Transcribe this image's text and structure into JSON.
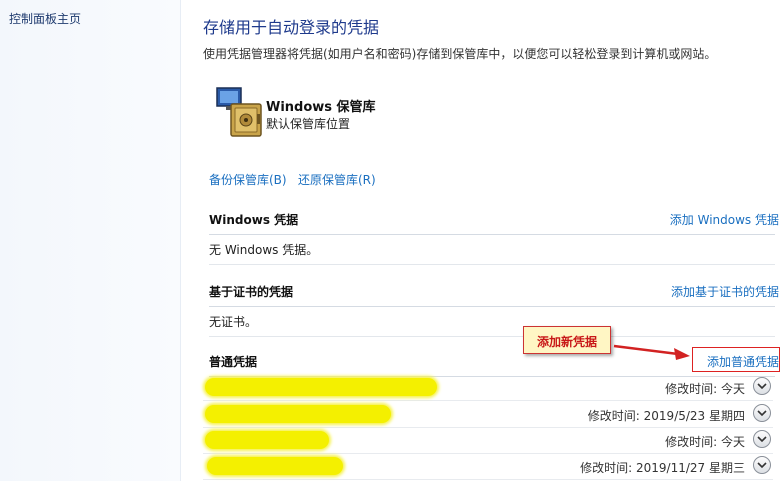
{
  "sidebar": {
    "home_link": "控制面板主页"
  },
  "page": {
    "title": "存储用于自动登录的凭据",
    "description": "使用凭据管理器将凭据(如用户名和密码)存储到保管库中，以便您可以轻松登录到计算机或网站。"
  },
  "vault": {
    "name": "Windows 保管库",
    "subtitle": "默认保管库位置",
    "icon": "vault-safe-icon",
    "backup_label": "备份保管库(B)",
    "restore_label": "还原保管库(R)"
  },
  "sections": {
    "windows": {
      "title": "Windows 凭据",
      "add_label": "添加 Windows 凭据",
      "empty_text": "无 Windows 凭据。"
    },
    "certificate": {
      "title": "基于证书的凭据",
      "add_label": "添加基于证书的凭据",
      "empty_text": "无证书。"
    },
    "generic": {
      "title": "普通凭据",
      "add_label": "添加普通凭据"
    }
  },
  "generic_credentials": [
    {
      "modified": "修改时间: 今天"
    },
    {
      "modified": "修改时间: 2019/5/23 星期四"
    },
    {
      "modified": "修改时间: 今天"
    },
    {
      "modified": "修改时间: 2019/11/27 星期三"
    }
  ],
  "annotation": {
    "callout_text": "添加新凭据",
    "color": "#d22222"
  },
  "colors": {
    "link": "#1a6fc0",
    "title": "#1e3a8c",
    "redaction": "#f4f000"
  }
}
